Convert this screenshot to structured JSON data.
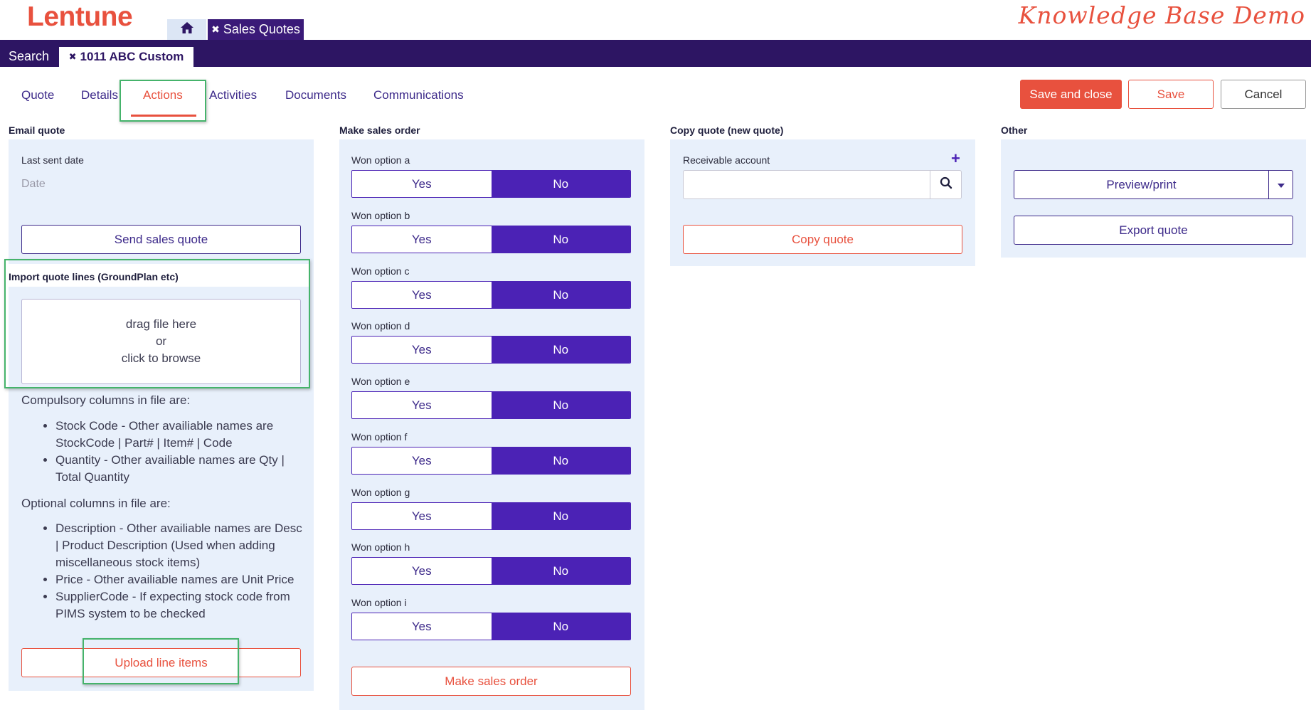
{
  "header": {
    "logo": "Lentune",
    "watermark": "Knowledge Base Demo",
    "home_icon": "home-icon",
    "app_tab_label": "Sales Quotes",
    "close_icon": "✖"
  },
  "navbar": {
    "search_label": "Search",
    "record_tab_label": "1011 ABC Custom"
  },
  "tabs": [
    {
      "label": "Quote"
    },
    {
      "label": "Details"
    },
    {
      "label": "Actions",
      "active": true
    },
    {
      "label": "Activities"
    },
    {
      "label": "Documents"
    },
    {
      "label": "Communications"
    }
  ],
  "toolbar": {
    "save_close_label": "Save and close",
    "save_label": "Save",
    "cancel_label": "Cancel"
  },
  "email_quote": {
    "title": "Email quote",
    "last_sent_label": "Last sent date",
    "last_sent_placeholder": "Date",
    "send_button": "Send sales quote"
  },
  "import_lines": {
    "title": "Import quote lines (GroundPlan etc)",
    "drop_line1": "drag file here",
    "drop_line2": "or",
    "drop_line3": "click to browse",
    "compulsory_heading": "Compulsory columns in file are:",
    "compulsory_items": [
      "Stock Code - Other availiable names are StockCode | Part# | Item# | Code",
      "Quantity - Other availiable names are Qty | Total Quantity"
    ],
    "optional_heading": "Optional columns in file are:",
    "optional_items": [
      "Description - Other availiable names are Desc | Product Description (Used when adding miscellaneous stock items)",
      "Price - Other availiable names are Unit Price",
      "SupplierCode - If expecting stock code from PIMS system to be checked"
    ],
    "upload_button": "Upload line items"
  },
  "sales_order": {
    "title": "Make sales order",
    "yes_label": "Yes",
    "no_label": "No",
    "options": [
      "Won option a",
      "Won option b",
      "Won option c",
      "Won option d",
      "Won option e",
      "Won option f",
      "Won option g",
      "Won option h",
      "Won option i"
    ],
    "selected": "No",
    "make_button": "Make sales order"
  },
  "copy_quote": {
    "title": "Copy quote (new quote)",
    "account_label": "Receivable account",
    "account_value": "",
    "add_icon": "plus-icon",
    "search_icon": "search-icon",
    "copy_button": "Copy quote"
  },
  "other": {
    "title": "Other",
    "preview_button": "Preview/print",
    "caret_icon": "caret-down-icon",
    "export_button": "Export quote"
  },
  "colors": {
    "brand": "#e8513e",
    "nav": "#2d1563",
    "accent": "#4b22b5",
    "panel": "#e8f0fb",
    "highlight": "#45b36b"
  }
}
